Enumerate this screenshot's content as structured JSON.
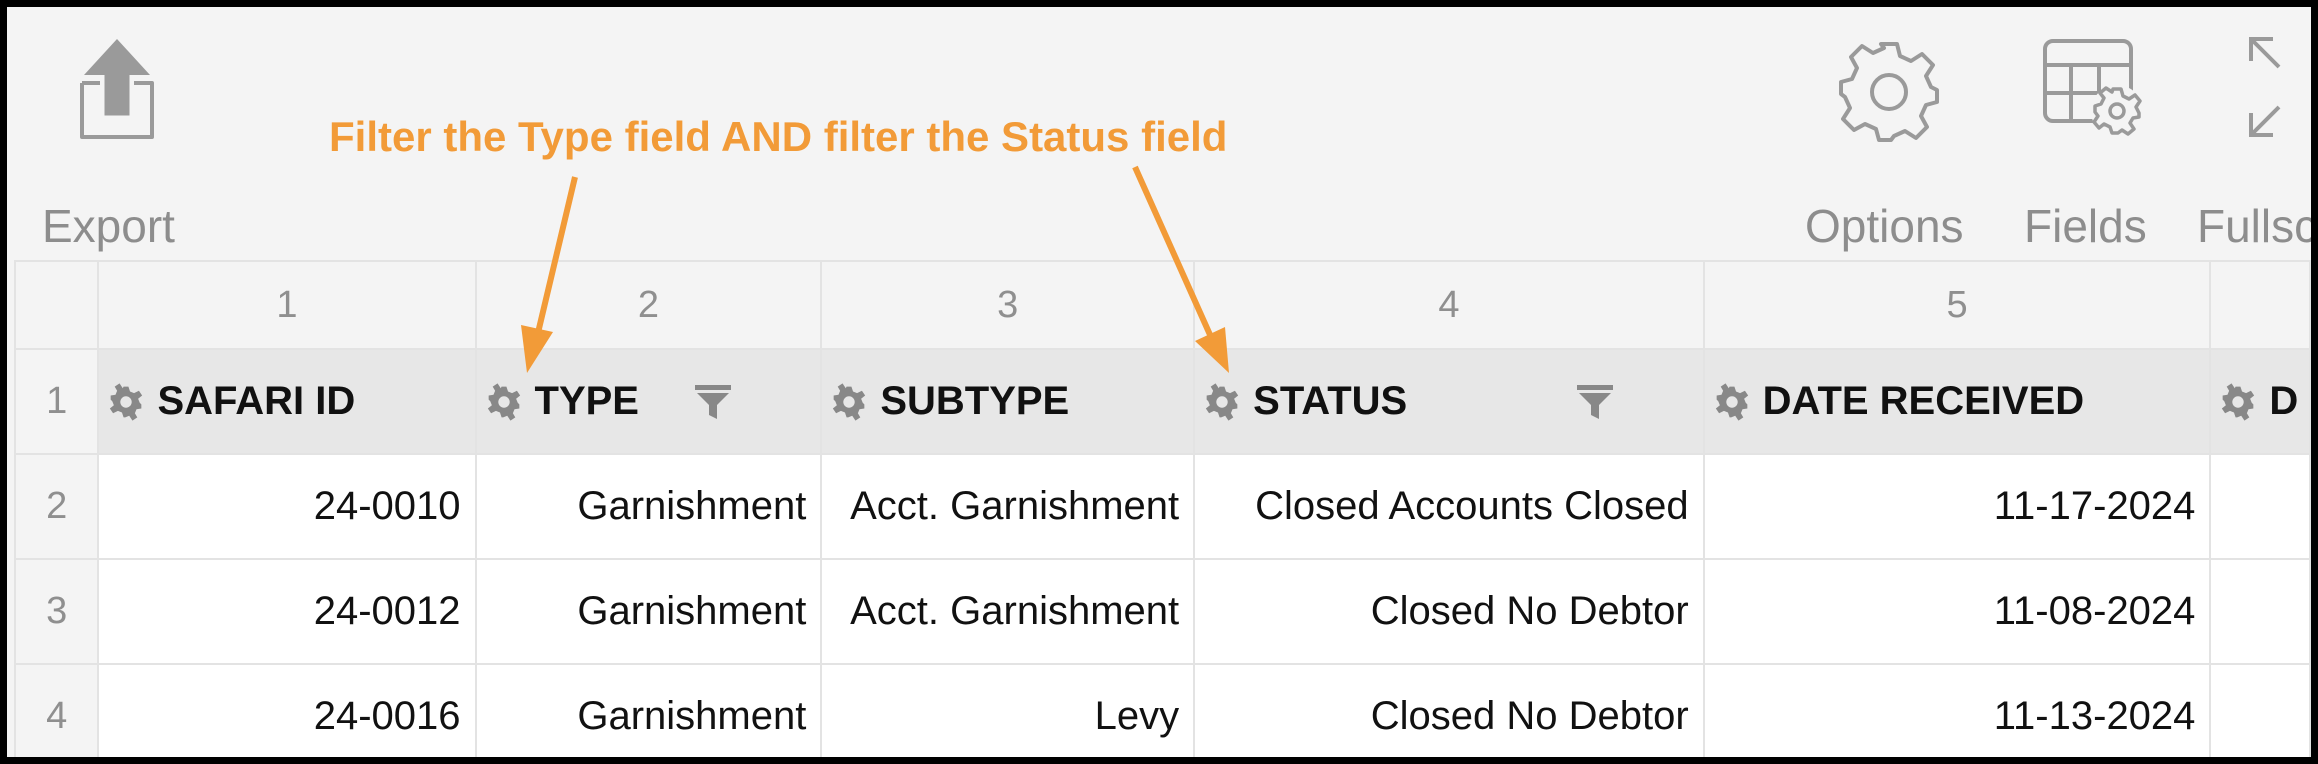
{
  "toolbar": {
    "export_label": "Export",
    "options_label": "Options",
    "fields_label": "Fields",
    "fullscreen_label": "Fullsc"
  },
  "annotation": {
    "text": "Filter the Type field AND filter the Status field",
    "color": "#f29b38"
  },
  "grid": {
    "column_numbers": [
      "1",
      "2",
      "3",
      "4",
      "5",
      ""
    ],
    "row_numbers": [
      "1",
      "2",
      "3",
      "4"
    ],
    "headers": [
      "SAFARI ID",
      "TYPE",
      "SUBTYPE",
      "STATUS",
      "DATE RECEIVED",
      "D"
    ],
    "filtered_columns": [
      "TYPE",
      "STATUS"
    ],
    "rows": [
      [
        "24-0010",
        "Garnishment",
        "Acct. Garnishment",
        "Closed Accounts Closed",
        "11-17-2024",
        ""
      ],
      [
        "24-0012",
        "Garnishment",
        "Acct. Garnishment",
        "Closed No Debtor",
        "11-08-2024",
        ""
      ],
      [
        "24-0016",
        "Garnishment",
        "Levy",
        "Closed No Debtor",
        "11-13-2024",
        ""
      ]
    ]
  }
}
